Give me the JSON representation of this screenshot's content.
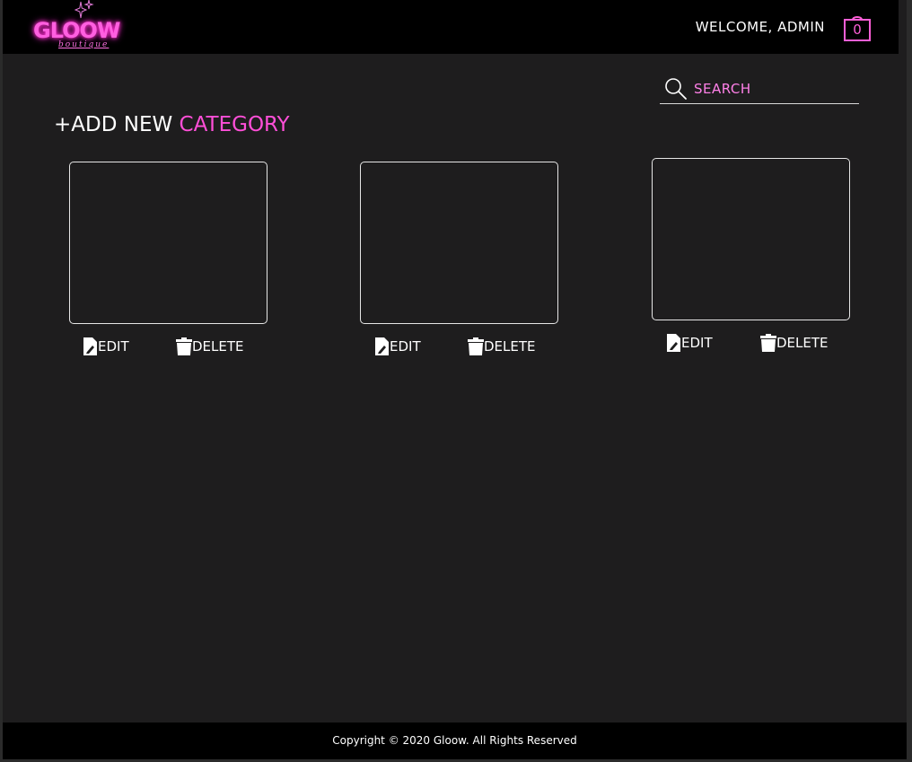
{
  "brand": {
    "name": "GLOOW",
    "tagline": "boutique"
  },
  "header": {
    "welcome_text": "WELCOME, ADMIN",
    "cart_count": "0"
  },
  "search": {
    "placeholder": "SEARCH"
  },
  "add_category": {
    "prefix": "+ADD NEW",
    "accent": "CATEGORY"
  },
  "categories": [
    {
      "edit_label": "EDIT",
      "delete_label": "DELETE"
    },
    {
      "edit_label": "EDIT",
      "delete_label": "DELETE"
    },
    {
      "edit_label": "EDIT",
      "delete_label": "DELETE"
    }
  ],
  "footer": {
    "copyright": "Copyright © 2020 Gloow. All Rights Reserved"
  },
  "colors": {
    "accent": "#ff4fd8",
    "background": "#1e1d1e",
    "header": "#000000"
  },
  "icons": {
    "search": "search-icon",
    "cart": "shopping-bag-icon",
    "edit": "edit-file-icon",
    "delete": "trash-icon"
  }
}
